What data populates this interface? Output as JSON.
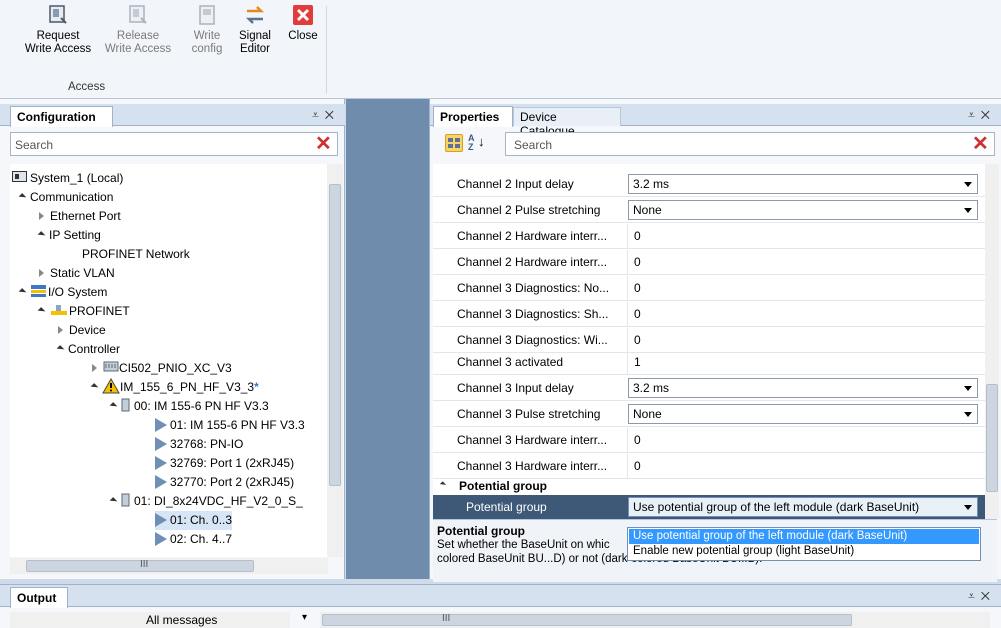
{
  "ribbon": {
    "buttons": {
      "request": {
        "line1": "Request",
        "line2": "Write Access"
      },
      "release": {
        "line1": "Release",
        "line2": "Write Access"
      },
      "write": {
        "line1": "Write",
        "line2": "config"
      },
      "signal": {
        "line1": "Signal",
        "line2": "Editor"
      },
      "close": {
        "line1": "Close"
      }
    },
    "group_label": "Access"
  },
  "config_pane": {
    "tab": "Configuration",
    "search_placeholder": "Search",
    "tree": [
      {
        "label": "System_1 (Local)"
      },
      {
        "label": "Communication"
      },
      {
        "label": "Ethernet Port"
      },
      {
        "label": "IP Setting"
      },
      {
        "label": "PROFINET Network"
      },
      {
        "label": "Static VLAN"
      },
      {
        "label": "I/O System"
      },
      {
        "label": "PROFINET"
      },
      {
        "label": "Device"
      },
      {
        "label": "Controller"
      },
      {
        "label": "CI502_PNIO_XC_V3"
      },
      {
        "label": "IM_155_6_PN_HF_V3_3"
      },
      {
        "label": "00: IM 155-6 PN HF V3.3"
      },
      {
        "label": "01: IM 155-6 PN HF V3.3"
      },
      {
        "label": "32768: PN-IO"
      },
      {
        "label": "32769: Port 1 (2xRJ45)"
      },
      {
        "label": "32770: Port 2 (2xRJ45)"
      },
      {
        "label": "01: DI_8x24VDC_HF_V2_0_S_"
      },
      {
        "label": "01: Ch. 0..3"
      },
      {
        "label": "02: Ch. 4..7"
      }
    ],
    "scroll_ticks": "III"
  },
  "props_pane": {
    "tab_active": "Properties",
    "tab_inactive": "Device Catalogue",
    "search_placeholder": "Search",
    "rows": [
      {
        "label": "Channel 2 Input delay",
        "value": "3.2 ms",
        "combo": true
      },
      {
        "label": "Channel 2 Pulse stretching",
        "value": "None",
        "combo": true
      },
      {
        "label": "Channel 2 Hardware interr...",
        "value": "0"
      },
      {
        "label": "Channel 2 Hardware interr...",
        "value": "0"
      },
      {
        "label": "Channel 3 Diagnostics: No...",
        "value": "0"
      },
      {
        "label": "Channel 3 Diagnostics: Sh...",
        "value": "0"
      },
      {
        "label": "Channel 3 Diagnostics: Wi...",
        "value": "0"
      },
      {
        "label": "Channel 3 activated",
        "value": "1"
      },
      {
        "label": "Channel 3 Input delay",
        "value": "3.2 ms",
        "combo": true
      },
      {
        "label": "Channel 3 Pulse stretching",
        "value": "None",
        "combo": true
      },
      {
        "label": "Channel 3 Hardware interr...",
        "value": "0"
      },
      {
        "label": "Channel 3 Hardware interr...",
        "value": "0"
      }
    ],
    "group": "Potential group",
    "selected_row": {
      "label": "Potential group",
      "value": "Use potential group of the left module (dark BaseUnit)"
    },
    "description": {
      "title": "Potential group",
      "line1": "Set whether the BaseUnit on whic",
      "line2": "colored BaseUnit BU...D) or not (dark-colored BaseUnit BU...B)."
    },
    "dropdown_options": [
      "Use potential group of the left module (dark BaseUnit)",
      "Enable new potential group (light BaseUnit)"
    ]
  },
  "output_pane": {
    "tab": "Output",
    "filter": "All messages",
    "scroll_ticks": "III"
  },
  "colors": {
    "accent": "#3e5877",
    "highlight": "#3399ff",
    "close_red": "#e23b3b",
    "warning": "#f2c200"
  },
  "icons": [
    "request-write-access-icon",
    "release-write-access-icon",
    "write-config-icon",
    "signal-editor-icon",
    "close-icon",
    "search-clear-icon",
    "pin-icon",
    "warning-icon",
    "module-icon",
    "sort-categorized-icon",
    "sort-alphabetical-icon"
  ]
}
